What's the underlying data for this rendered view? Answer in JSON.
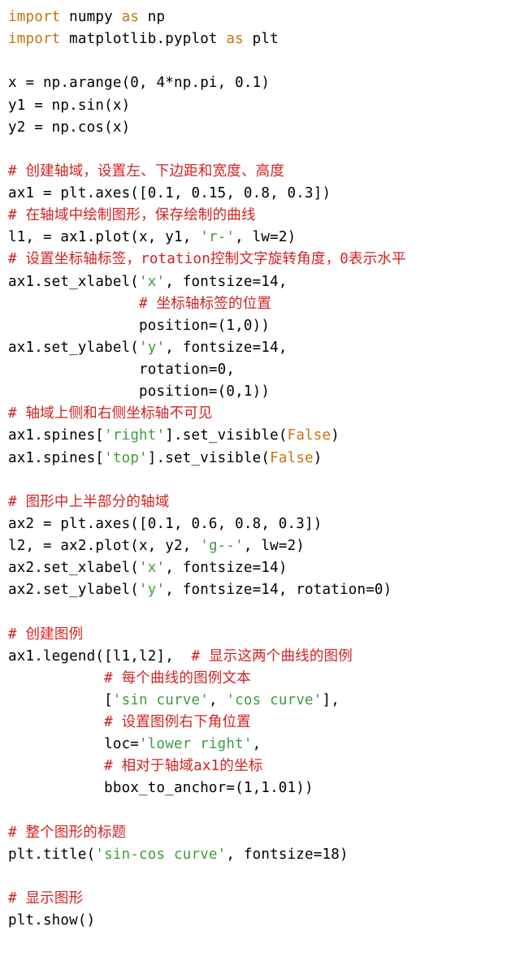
{
  "t": {
    "l1a": "import",
    "l1b": " numpy ",
    "l1c": "as",
    "l1d": " np",
    "l2a": "import",
    "l2b": " matplotlib.pyplot ",
    "l2c": "as",
    "l2d": " plt",
    "blank1": "",
    "l3": "x = np.arange(0, 4*np.pi, 0.1)",
    "l4": "y1 = np.sin(x)",
    "l5": "y2 = np.cos(x)",
    "blank2": "",
    "c1": "# 创建轴域，设置左、下边距和宽度、高度",
    "l6": "ax1 = plt.axes([0.1, 0.15, 0.8, 0.3])",
    "c2": "# 在轴域中绘制图形，保存绘制的曲线",
    "l7a": "l1, = ax1.plot(x, y1, ",
    "l7s": "'r-'",
    "l7b": ", lw=2)",
    "c3a": "# 设置坐标轴标签，",
    "c3b": "rotation",
    "c3c": "控制文字旋转角度，",
    "c3d": "0",
    "c3e": "表示水平",
    "l8a": "ax1.set_xlabel(",
    "l8s": "'x'",
    "l8b": ", fontsize=14,",
    "c4": "               # 坐标轴标签的位置",
    "l9": "               position=(1,0))",
    "l10a": "ax1.set_ylabel(",
    "l10s": "'y'",
    "l10b": ", fontsize=14,",
    "l11": "               rotation=0,",
    "l12": "               position=(0,1))",
    "c5": "# 轴域上侧和右侧坐标轴不可见",
    "l13a": "ax1.spines[",
    "l13s": "'right'",
    "l13b": "].set_visible(",
    "l13f": "False",
    "l13c": ")",
    "l14a": "ax1.spines[",
    "l14s": "'top'",
    "l14b": "].set_visible(",
    "l14f": "False",
    "l14c": ")",
    "blank3": "",
    "c6": "# 图形中上半部分的轴域",
    "l15": "ax2 = plt.axes([0.1, 0.6, 0.8, 0.3])",
    "l16a": "l2, = ax2.plot(x, y2, ",
    "l16s": "'g--'",
    "l16b": ", lw=2)",
    "l17a": "ax2.set_xlabel(",
    "l17s": "'x'",
    "l17b": ", fontsize=14)",
    "l18a": "ax2.set_ylabel(",
    "l18s": "'y'",
    "l18b": ", fontsize=14, rotation=0)",
    "blank4": "",
    "c7": "# 创建图例",
    "l19a": "ax1.legend([l1,l2],  ",
    "c8": "# 显示这两个曲线的图例",
    "c9": "           # 每个曲线的图例文本",
    "l20a": "           [",
    "l20s1": "'sin curve'",
    "l20b": ", ",
    "l20s2": "'cos curve'",
    "l20c": "],",
    "c10": "           # 设置图例右下角位置",
    "l21a": "           loc=",
    "l21s": "'lower right'",
    "l21b": ",",
    "c11a": "           # 相对于轴域",
    "c11b": "ax1",
    "c11c": "的坐标",
    "l22": "           bbox_to_anchor=(1,1.01))",
    "blank5": "",
    "c12": "# 整个图形的标题",
    "l23a": "plt.title(",
    "l23s": "'sin-cos curve'",
    "l23b": ", fontsize=18)",
    "blank6": "",
    "c13": "# 显示图形",
    "l24": "plt.show()"
  }
}
